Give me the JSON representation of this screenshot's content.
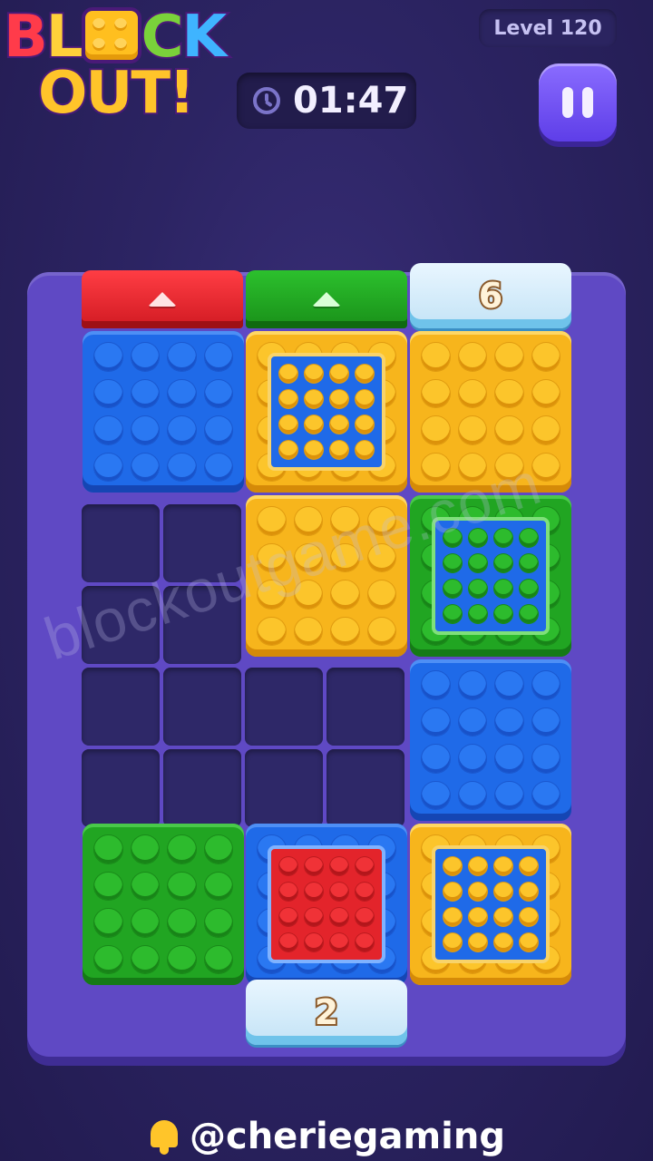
{
  "logo": {
    "line1": [
      "B",
      "L",
      "C",
      "K"
    ],
    "line2": "OUT!"
  },
  "header": {
    "level": "Level 120",
    "timer": "01:47"
  },
  "gates": {
    "red_top": {
      "color": "#e3242b",
      "icon": "up-arrow-icon"
    },
    "green_top": {
      "color": "#21a522",
      "icon": "up-arrow-icon"
    },
    "ice_top": {
      "count": "6"
    },
    "ice_bottom": {
      "count": "2"
    }
  },
  "blocks": [
    {
      "id": "blue-r1c1",
      "color": "blue"
    },
    {
      "id": "yellow-blue-r1c2",
      "color": "yellow",
      "inner": "blue"
    },
    {
      "id": "yellow-r1c3",
      "color": "yellow"
    },
    {
      "id": "yellow-r2c2",
      "color": "yellow"
    },
    {
      "id": "green-blue-r2c3",
      "color": "green",
      "inner": "blue"
    },
    {
      "id": "blue-r3c3",
      "color": "blue"
    },
    {
      "id": "green-r4c1",
      "color": "green"
    },
    {
      "id": "blue-red-r4c2",
      "color": "blue",
      "inner": "red"
    },
    {
      "id": "yellow-blue-r4c3",
      "color": "yellow",
      "inner": "blue"
    }
  ],
  "watermark": "blockoutgame.com",
  "footer": {
    "handle": "@cheriegaming"
  },
  "colors": {
    "blue": "#1f6ae8",
    "yellow": "#f7b51c",
    "green": "#21a522",
    "red": "#e3242b",
    "board": "#5f49c4"
  }
}
